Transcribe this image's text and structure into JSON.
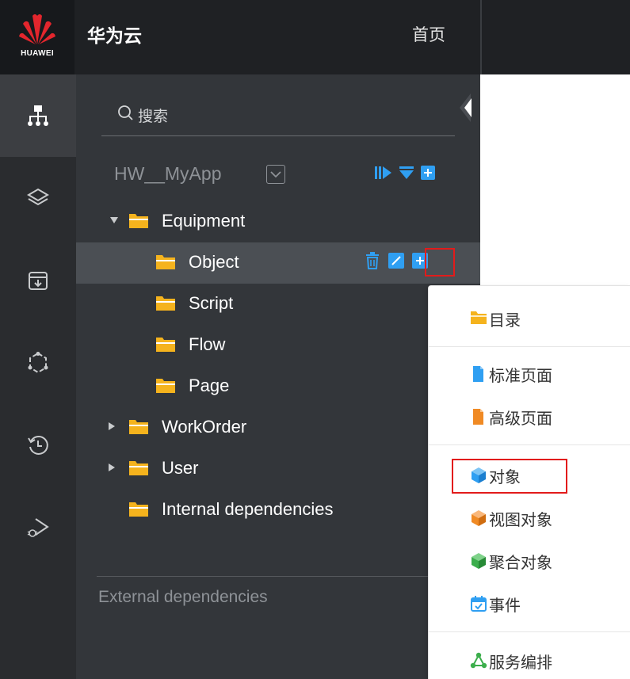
{
  "header": {
    "logo_text": "HUAWEI",
    "brand": "华为云",
    "home": "首页"
  },
  "rail": {
    "items": [
      {
        "icon": "org-tree-icon",
        "active": true
      },
      {
        "icon": "layers-icon",
        "active": false
      },
      {
        "icon": "package-icon",
        "active": false
      },
      {
        "icon": "hexagon-nodes-icon",
        "active": false
      },
      {
        "icon": "history-icon",
        "active": false
      },
      {
        "icon": "debug-run-icon",
        "active": false
      }
    ]
  },
  "tree": {
    "search_placeholder": "搜索",
    "app_name": "HW__MyApp",
    "nodes": [
      {
        "label": "Equipment",
        "caret": "expanded"
      },
      {
        "label": "Object",
        "selected": true
      },
      {
        "label": "Script"
      },
      {
        "label": "Flow"
      },
      {
        "label": "Page"
      },
      {
        "label": "WorkOrder",
        "caret": "collapsed"
      },
      {
        "label": "User",
        "caret": "collapsed"
      },
      {
        "label": "Internal dependencies"
      }
    ],
    "external_dependencies": "External dependencies"
  },
  "context_menu": {
    "items": [
      {
        "label": "目录",
        "icon": "folder-icon"
      },
      {
        "label": "标准页面",
        "icon": "page-icon"
      },
      {
        "label": "高级页面",
        "icon": "advanced-page-icon"
      },
      {
        "label": "对象",
        "icon": "cube-icon"
      },
      {
        "label": "视图对象",
        "icon": "view-cube-icon"
      },
      {
        "label": "聚合对象",
        "icon": "aggregate-cube-icon"
      },
      {
        "label": "事件",
        "icon": "event-icon"
      },
      {
        "label": "服务编排",
        "icon": "service-orchestration-icon"
      }
    ]
  },
  "colors": {
    "folder": "#f5b31d",
    "accent_blue": "#2f9ff2",
    "highlight_red": "#e21b1b"
  }
}
